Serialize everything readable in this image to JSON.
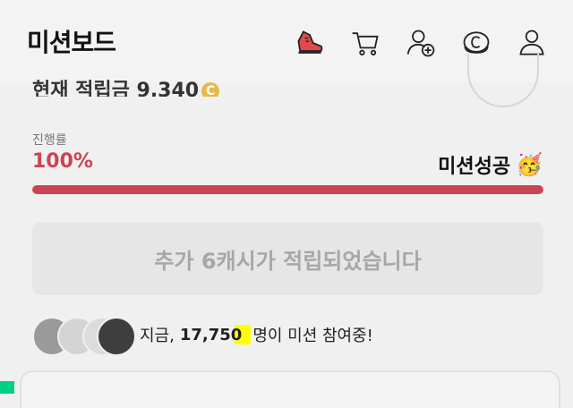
{
  "header": {
    "title": "미션보드",
    "icons": [
      "shoe-icon",
      "cart-icon",
      "add-friend-icon",
      "cash-icon",
      "user-icon"
    ]
  },
  "summary": {
    "cut_text": "현재 적립금 9,340",
    "coin_symbol": "C"
  },
  "progress": {
    "label": "진행률",
    "percent_text": "100%",
    "percent": 100,
    "status": "미션성공",
    "party_emoji": "🥳",
    "accent": "#c94552"
  },
  "reward": {
    "message": "추가 6캐시가 적립되었습니다"
  },
  "participants": {
    "prefix": "지금,",
    "count": "17,750",
    "suffix": "명이 미션 참여중!"
  }
}
